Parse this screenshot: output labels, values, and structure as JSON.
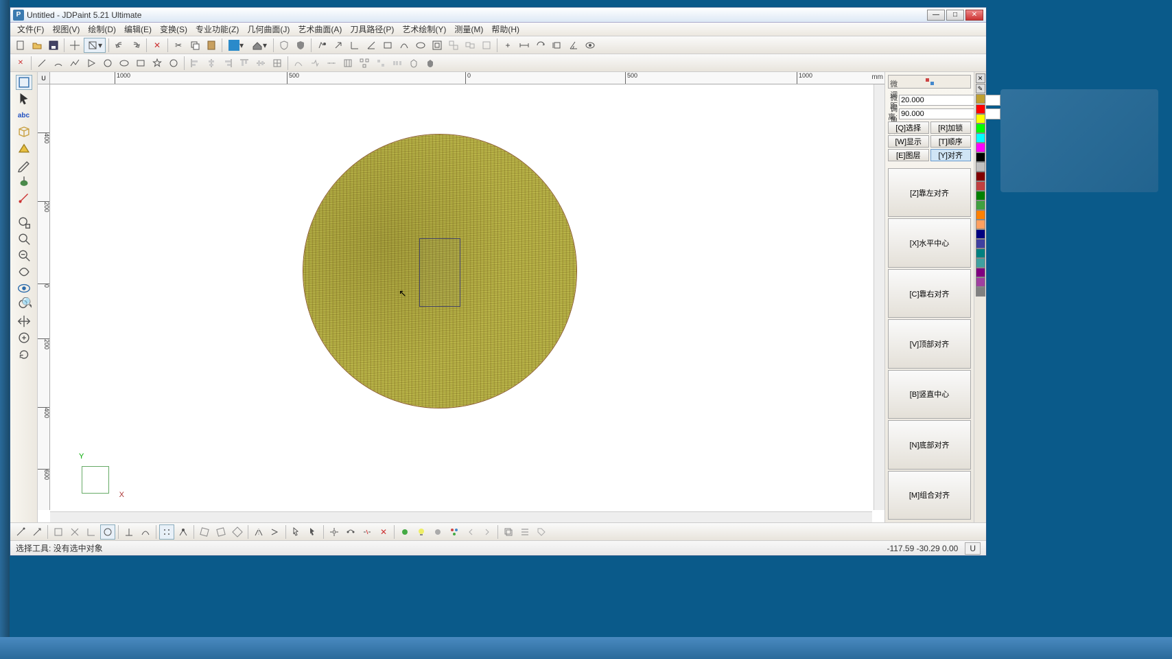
{
  "window": {
    "title": "Untitled - JDPaint 5.21 Ultimate"
  },
  "menu": [
    "文件(F)",
    "视图(V)",
    "绘制(D)",
    "编辑(E)",
    "变换(S)",
    "专业功能(Z)",
    "几何曲面(J)",
    "艺术曲面(A)",
    "刀具路径(P)",
    "艺术绘制(Y)",
    "测量(M)",
    "帮助(H)"
  ],
  "ruler": {
    "unit": "mm",
    "labels_h": [
      "1000",
      "500",
      "0",
      "500",
      "1000"
    ],
    "labels_v": [
      "4\n0\n0",
      "2\n0\n0",
      "0",
      "2\n0\n0",
      "4\n0\n0",
      "6\n0\n0"
    ]
  },
  "right": {
    "prop1": {
      "label": "微调距离:",
      "value": "20.000"
    },
    "prop2": {
      "label": "微调角度:",
      "value": "90.000"
    },
    "buttons": [
      [
        "[Q]选择",
        "[R]加锁"
      ],
      [
        "[W]显示",
        "[T]顺序"
      ],
      [
        "[E]图层",
        "[Y]对齐"
      ]
    ],
    "align": [
      "[Z]靠左对齐",
      "[X]水平中心",
      "[C]靠右对齐",
      "[V]顶部对齐",
      "[B]竖直中心",
      "[N]底部对齐",
      "[M]组合对齐"
    ]
  },
  "colors": [
    "#ff0000",
    "#ffff00",
    "#00ff00",
    "#00ffff",
    "#ff00ff",
    "#000000",
    "#c0c0c0",
    "#800000",
    "#c04040",
    "#008000",
    "#40a040",
    "#ff8000",
    "#ffa060",
    "#000080",
    "#4040a0",
    "#008080",
    "#40a0a0",
    "#800080",
    "#a040a0",
    "#808080"
  ],
  "status": {
    "text": "选择工具: 没有选中对象",
    "coord": "-117.59  -30.29  0.00",
    "unit_btn": "U"
  },
  "axis": {
    "x": "X",
    "y": "Y"
  },
  "ruler_corner": "U"
}
